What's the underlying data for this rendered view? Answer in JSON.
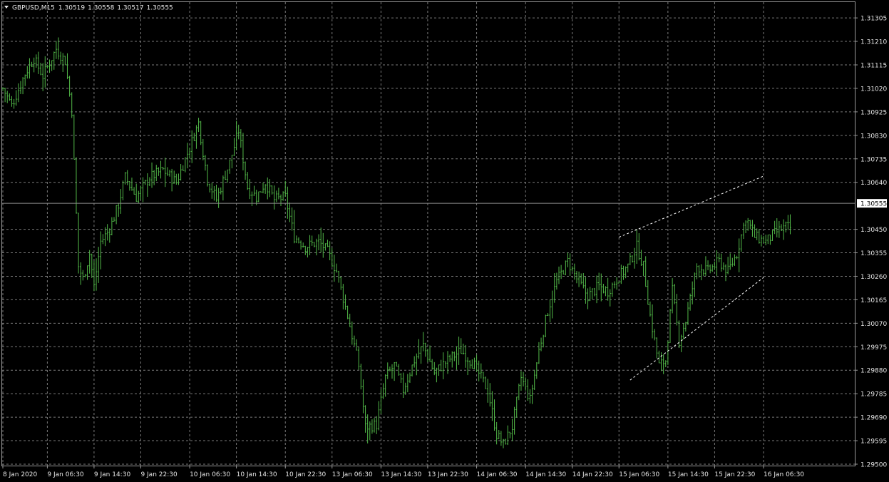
{
  "header": {
    "symbol": "GBPUSD",
    "timeframe": "M15",
    "open": "1.30519",
    "high": "1.30558",
    "low": "1.30517",
    "close": "1.30555"
  },
  "colors": {
    "background": "#000000",
    "bars": "#52b948",
    "grid": "#7a7a7a",
    "axis_text": "#e6e6e6",
    "price_line": "#8c8c8c",
    "trendline": "#ffffff"
  },
  "chart_data": {
    "type": "bar",
    "title": "GBPUSD,M15",
    "xlabel": "",
    "ylabel": "",
    "ylim": [
      1.295,
      1.3135
    ],
    "grid": true,
    "current_price": 1.30555,
    "current_price_label": "1.30555",
    "y_ticks": [
      "1.31305",
      "1.31210",
      "1.31115",
      "1.31020",
      "1.30925",
      "1.30830",
      "1.30735",
      "1.30640",
      "1.30450",
      "1.30355",
      "1.30260",
      "1.30165",
      "1.30070",
      "1.29975",
      "1.29880",
      "1.29785",
      "1.29690",
      "1.29595",
      "1.29500"
    ],
    "x_ticks": [
      {
        "label": "8 Jan 2020",
        "index": 0
      },
      {
        "label": "9 Jan 06:30",
        "index": 20
      },
      {
        "label": "9 Jan 14:30",
        "index": 41
      },
      {
        "label": "9 Jan 22:30",
        "index": 62
      },
      {
        "label": "10 Jan 06:30",
        "index": 84
      },
      {
        "label": "10 Jan 14:30",
        "index": 105
      },
      {
        "label": "10 Jan 22:30",
        "index": 127
      },
      {
        "label": "13 Jan 06:30",
        "index": 148
      },
      {
        "label": "13 Jan 14:30",
        "index": 170
      },
      {
        "label": "13 Jan 22:30",
        "index": 191
      },
      {
        "label": "14 Jan 06:30",
        "index": 213
      },
      {
        "label": "14 Jan 14:30",
        "index": 235
      },
      {
        "label": "14 Jan 22:30",
        "index": 256
      },
      {
        "label": "15 Jan 06:30",
        "index": 277
      },
      {
        "label": "15 Jan 14:30",
        "index": 299
      },
      {
        "label": "15 Jan 22:30",
        "index": 320
      },
      {
        "label": "16 Jan 06:30",
        "index": 342
      }
    ],
    "bar_count": 355,
    "key_points": [
      {
        "index": 0,
        "value": 1.3102
      },
      {
        "index": 4,
        "value": 1.3095
      },
      {
        "index": 10,
        "value": 1.3108
      },
      {
        "index": 14,
        "value": 1.3114
      },
      {
        "index": 18,
        "value": 1.3107
      },
      {
        "index": 24,
        "value": 1.3118
      },
      {
        "index": 28,
        "value": 1.3113
      },
      {
        "index": 31,
        "value": 1.3093
      },
      {
        "index": 34,
        "value": 1.303
      },
      {
        "index": 36,
        "value": 1.3025
      },
      {
        "index": 39,
        "value": 1.3035
      },
      {
        "index": 41,
        "value": 1.3022
      },
      {
        "index": 44,
        "value": 1.304
      },
      {
        "index": 48,
        "value": 1.3045
      },
      {
        "index": 52,
        "value": 1.3055
      },
      {
        "index": 55,
        "value": 1.3066
      },
      {
        "index": 60,
        "value": 1.3058
      },
      {
        "index": 66,
        "value": 1.3066
      },
      {
        "index": 72,
        "value": 1.3069
      },
      {
        "index": 78,
        "value": 1.3064
      },
      {
        "index": 84,
        "value": 1.3078
      },
      {
        "index": 88,
        "value": 1.3088
      },
      {
        "index": 92,
        "value": 1.3065
      },
      {
        "index": 96,
        "value": 1.3057
      },
      {
        "index": 102,
        "value": 1.3072
      },
      {
        "index": 106,
        "value": 1.3085
      },
      {
        "index": 110,
        "value": 1.3062
      },
      {
        "index": 114,
        "value": 1.3058
      },
      {
        "index": 118,
        "value": 1.3064
      },
      {
        "index": 122,
        "value": 1.3057
      },
      {
        "index": 127,
        "value": 1.3058
      },
      {
        "index": 131,
        "value": 1.3042
      },
      {
        "index": 136,
        "value": 1.3038
      },
      {
        "index": 142,
        "value": 1.304
      },
      {
        "index": 146,
        "value": 1.3036
      },
      {
        "index": 150,
        "value": 1.3028
      },
      {
        "index": 155,
        "value": 1.301
      },
      {
        "index": 160,
        "value": 1.299
      },
      {
        "index": 163,
        "value": 1.2965
      },
      {
        "index": 168,
        "value": 1.2966
      },
      {
        "index": 172,
        "value": 1.2985
      },
      {
        "index": 176,
        "value": 1.299
      },
      {
        "index": 180,
        "value": 1.298
      },
      {
        "index": 185,
        "value": 1.2992
      },
      {
        "index": 189,
        "value": 1.2998
      },
      {
        "index": 194,
        "value": 1.2987
      },
      {
        "index": 200,
        "value": 1.2992
      },
      {
        "index": 206,
        "value": 1.2996
      },
      {
        "index": 212,
        "value": 1.299
      },
      {
        "index": 218,
        "value": 1.298
      },
      {
        "index": 222,
        "value": 1.2962
      },
      {
        "index": 225,
        "value": 1.2958
      },
      {
        "index": 229,
        "value": 1.2965
      },
      {
        "index": 233,
        "value": 1.2985
      },
      {
        "index": 237,
        "value": 1.2976
      },
      {
        "index": 241,
        "value": 1.2996
      },
      {
        "index": 245,
        "value": 1.3012
      },
      {
        "index": 249,
        "value": 1.3024
      },
      {
        "index": 254,
        "value": 1.3032
      },
      {
        "index": 258,
        "value": 1.3025
      },
      {
        "index": 263,
        "value": 1.3018
      },
      {
        "index": 268,
        "value": 1.3022
      },
      {
        "index": 272,
        "value": 1.302
      },
      {
        "index": 277,
        "value": 1.3026
      },
      {
        "index": 281,
        "value": 1.303
      },
      {
        "index": 285,
        "value": 1.3038
      },
      {
        "index": 288,
        "value": 1.303
      },
      {
        "index": 291,
        "value": 1.301
      },
      {
        "index": 295,
        "value": 1.299
      },
      {
        "index": 298,
        "value": 1.2992
      },
      {
        "index": 301,
        "value": 1.302
      },
      {
        "index": 304,
        "value": 1.3
      },
      {
        "index": 307,
        "value": 1.3008
      },
      {
        "index": 312,
        "value": 1.303
      },
      {
        "index": 317,
        "value": 1.3028
      },
      {
        "index": 322,
        "value": 1.3032
      },
      {
        "index": 326,
        "value": 1.3028
      },
      {
        "index": 330,
        "value": 1.3035
      },
      {
        "index": 334,
        "value": 1.305
      },
      {
        "index": 338,
        "value": 1.3042
      },
      {
        "index": 343,
        "value": 1.304
      },
      {
        "index": 348,
        "value": 1.3044
      },
      {
        "index": 352,
        "value": 1.3046
      },
      {
        "index": 357,
        "value": 1.3045
      },
      {
        "index": 362,
        "value": 1.3048
      },
      {
        "index": 366,
        "value": 1.304
      },
      {
        "index": 369,
        "value": 1.3032
      },
      {
        "index": 372,
        "value": 1.3045
      },
      {
        "index": 375,
        "value": 1.306
      },
      {
        "index": 379,
        "value": 1.3052
      },
      {
        "index": 382,
        "value": 1.3055
      }
    ],
    "trendlines": [
      {
        "from": {
          "index": 277,
          "value": 1.30418
        },
        "to": {
          "index": 342,
          "value": 1.30665
        }
      },
      {
        "from": {
          "index": 282,
          "value": 1.2984
        },
        "to": {
          "index": 342,
          "value": 1.30255
        }
      }
    ]
  }
}
